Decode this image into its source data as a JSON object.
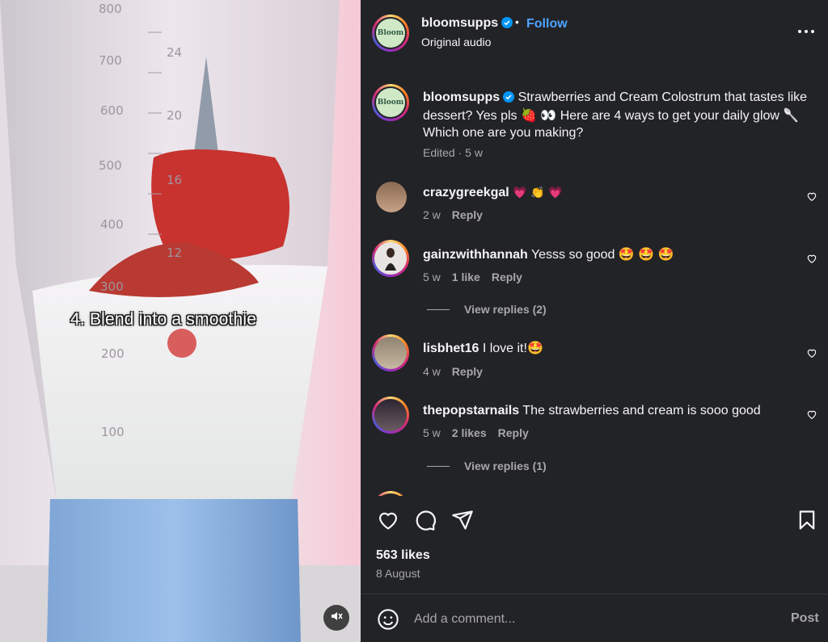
{
  "video": {
    "overlay_caption": "4. Blend into a smoothie",
    "mute_icon": "muted-speaker-icon",
    "measure_labels": [
      "800",
      "700",
      "600",
      "500",
      "400",
      "300",
      "200",
      "100"
    ],
    "oz_labels": [
      "24",
      "20",
      "16",
      "12"
    ]
  },
  "post_header": {
    "username": "bloomsupps",
    "separator": "•",
    "follow_label": "Follow",
    "audio_label": "Original audio",
    "avatar_text": "Bloom",
    "more_icon": "more-options-icon"
  },
  "caption": {
    "username": "bloomsupps",
    "avatar_text": "Bloom",
    "text": "Strawberries and Cream Colostrum that tastes like dessert? Yes pls 🍓 👀  Here are 4 ways to get your daily glow 🥄 Which one are you making?",
    "meta": "Edited · 5 w"
  },
  "comments": [
    {
      "username": "crazygreekgal",
      "text": "💗 👏 💗",
      "age": "2 w",
      "likes": "",
      "reply_label": "Reply",
      "view_replies": ""
    },
    {
      "username": "gainzwithhannah",
      "text": "Yesss so good 🤩 🤩 🤩",
      "age": "5 w",
      "likes": "1 like",
      "reply_label": "Reply",
      "view_replies": "View replies (2)"
    },
    {
      "username": "lisbhet16",
      "text": "I love it!🤩",
      "age": "4 w",
      "likes": "",
      "reply_label": "Reply",
      "view_replies": ""
    },
    {
      "username": "thepopstarnails",
      "text": "The strawberries and cream is sooo good",
      "age": "5 w",
      "likes": "2 likes",
      "reply_label": "Reply",
      "view_replies": "View replies (1)"
    }
  ],
  "engagement": {
    "likes": "563 likes",
    "date": "8 August"
  },
  "composer": {
    "placeholder": "Add a comment...",
    "post_label": "Post"
  },
  "colors": {
    "panel_bg": "#222327",
    "link_blue": "#4da3ff",
    "verified_blue": "#0095f6",
    "muted_text": "#a8a8a8"
  }
}
